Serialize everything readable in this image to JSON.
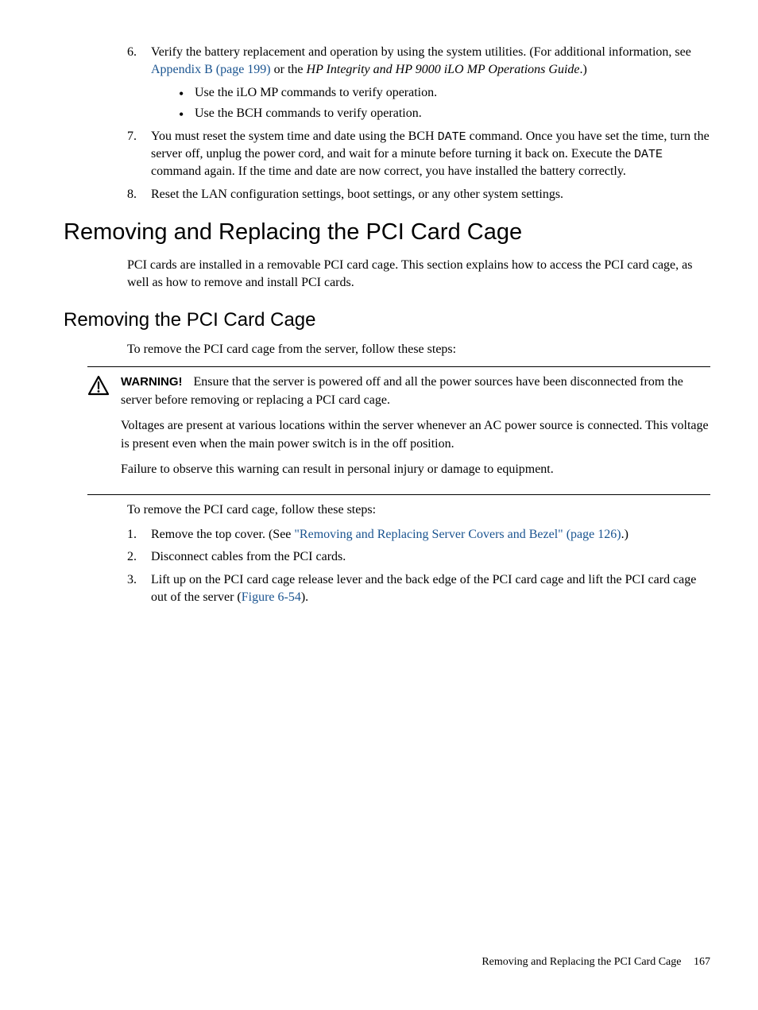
{
  "steps_a": {
    "s6": {
      "num": "6.",
      "text_before": "Verify the battery replacement and operation by using the system utilities. (For additional information, see ",
      "link": "Appendix B (page 199)",
      "text_mid": " or the ",
      "italic": "HP Integrity and HP 9000 iLO MP Operations Guide",
      "text_after": ".)",
      "bullet1": "Use the iLO MP commands to verify operation.",
      "bullet2": "Use the BCH commands to verify operation."
    },
    "s7": {
      "num": "7.",
      "part1": "You must reset the system time and date using the BCH ",
      "mono1": "DATE",
      "part2": " command. Once you have set the time, turn the server off, unplug the power cord, and wait for a minute before turning it back on. Execute the ",
      "mono2": "DATE",
      "part3": " command again. If the time and date are now correct, you have installed the battery correctly."
    },
    "s8": {
      "num": "8.",
      "text": "Reset the LAN configuration settings, boot settings, or any other system settings."
    }
  },
  "h1": "Removing and Replacing the PCI Card Cage",
  "p1": "PCI cards are installed in a removable PCI card cage. This section explains how to access the PCI card cage, as well as how to remove and install PCI cards.",
  "h2": "Removing the PCI Card Cage",
  "p2": "To remove the PCI card cage from the server, follow these steps:",
  "warning": {
    "label": "WARNING!",
    "para1": "Ensure that the server is powered off and all the power sources have been disconnected from the server before removing or replacing a PCI card cage.",
    "para2": "Voltages are present at various locations within the server whenever an AC power source is connected. This voltage is present even when the main power switch is in the off position.",
    "para3": "Failure to observe this warning can result in personal injury or damage to equipment."
  },
  "p3": "To remove the PCI card cage, follow these steps:",
  "steps_b": {
    "s1": {
      "num": "1.",
      "before": "Remove the top cover. (See ",
      "link": "\"Removing and Replacing Server Covers and Bezel\" (page 126)",
      "after": ".)"
    },
    "s2": {
      "num": "2.",
      "text": "Disconnect cables from the PCI cards."
    },
    "s3": {
      "num": "3.",
      "before": "Lift up on the PCI card cage release lever and the back edge of the PCI card cage and lift the PCI card cage out of the server (",
      "link": "Figure 6-54",
      "after": ")."
    }
  },
  "footer": {
    "title": "Removing and Replacing the PCI Card Cage",
    "page": "167"
  }
}
